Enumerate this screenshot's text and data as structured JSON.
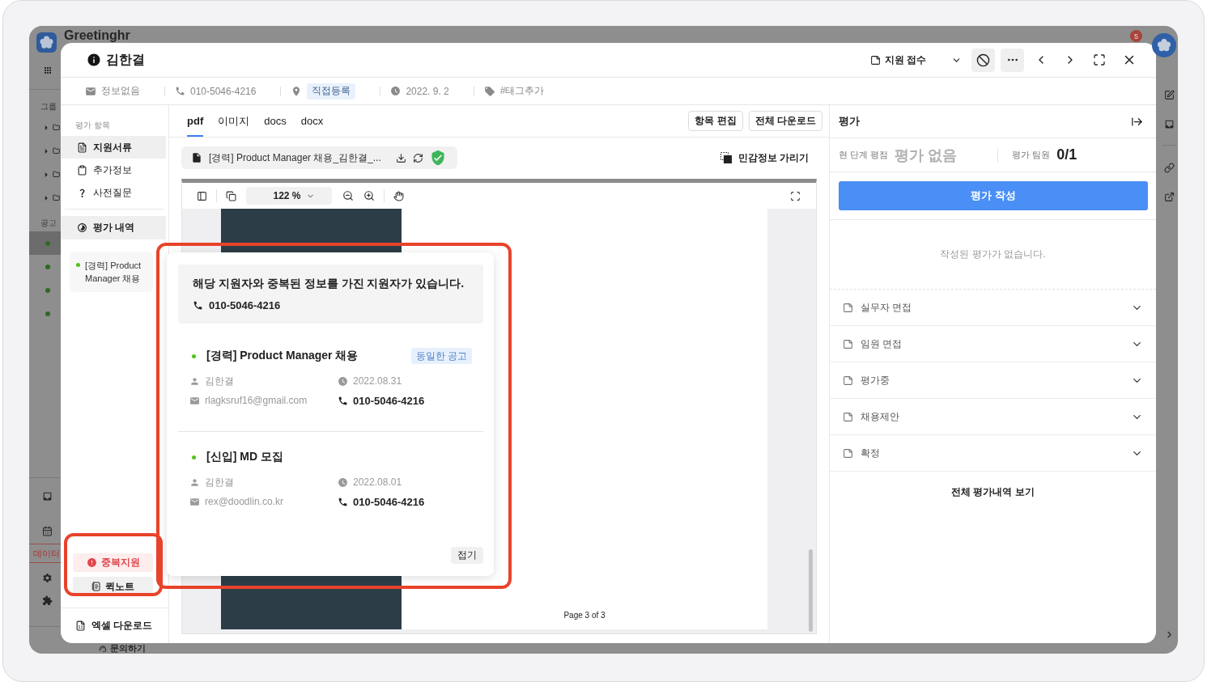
{
  "background_app": {
    "brand": "Greetinghr",
    "notification_count": "5",
    "group_label": "그룹",
    "group_rows": [
      {
        "expanded": false
      },
      {
        "expanded": false
      },
      {
        "expanded": false
      },
      {
        "expanded": false
      }
    ],
    "posting_label": "공고",
    "posting_rows": [
      {
        "selected": true
      },
      {
        "selected": false
      },
      {
        "selected": false
      },
      {
        "selected": false
      }
    ],
    "data_menu": "데이터",
    "help_link": "문의하기"
  },
  "applicant": {
    "name": "김한결",
    "stage": "지원 접수",
    "email": "정보없음",
    "phone": "010-5046-4216",
    "source": "직접등록",
    "applied_date": "2022. 9. 2",
    "tag_action": "#태그추가"
  },
  "nav": {
    "section_label": "평가 항목",
    "items": [
      {
        "label": "지원서류",
        "selected": true
      },
      {
        "label": "추가정보",
        "selected": false
      },
      {
        "label": "사전질문",
        "selected": false
      }
    ],
    "history_button": "평가 내역",
    "postings": [
      {
        "title": "[경력] Product Manager 채용"
      }
    ],
    "duplicate_button": "중복지원",
    "quicknote_button": "퀵노트",
    "excel_button": "엑셀 다운로드"
  },
  "documents": {
    "tabs": [
      {
        "label": "pdf",
        "selected": true
      },
      {
        "label": "이미지",
        "selected": false
      },
      {
        "label": "docs",
        "selected": false
      },
      {
        "label": "docx",
        "selected": false
      }
    ],
    "actions": [
      "항목 편집",
      "전체 다운로드"
    ],
    "file_name": "[경력] Product Manager 채용_김한결_...",
    "verified": true,
    "mask_button": "민감정보 가리기",
    "zoom": "122 %",
    "page_label": "Page 3 of 3"
  },
  "duplicate_popup": {
    "message": "해당 지원자와 중복된 정보를 가진 지원자가 있습니다.",
    "phone": "010-5046-4216",
    "applications": [
      {
        "title": "[경력] Product Manager 채용",
        "badge": "동일한 공고",
        "name": "김한결",
        "date": "2022.08.31",
        "email": "rlagksruf16@gmail.com",
        "phone": "010-5046-4216"
      },
      {
        "title": "[신입] MD 모집",
        "name": "김한결",
        "date": "2022.08.01",
        "email": "rex@doodlin.co.kr",
        "phone": "010-5046-4216"
      }
    ],
    "collapse_button": "접기"
  },
  "evaluation": {
    "title": "평가",
    "score_label": "현 단계 평점",
    "score": "평가 없음",
    "members_label": "평가 팀원",
    "members": "0/1",
    "write_button": "평가 작성",
    "empty_message": "작성된 평가가 없습니다.",
    "stages": [
      {
        "label": "실무자 면접",
        "expanded": false
      },
      {
        "label": "임원 면접",
        "expanded": false
      },
      {
        "label": "평가중",
        "expanded": false
      },
      {
        "label": "채용제안",
        "expanded": false
      },
      {
        "label": "확정",
        "expanded": false
      }
    ],
    "view_all": "전체 평가내역 보기"
  }
}
